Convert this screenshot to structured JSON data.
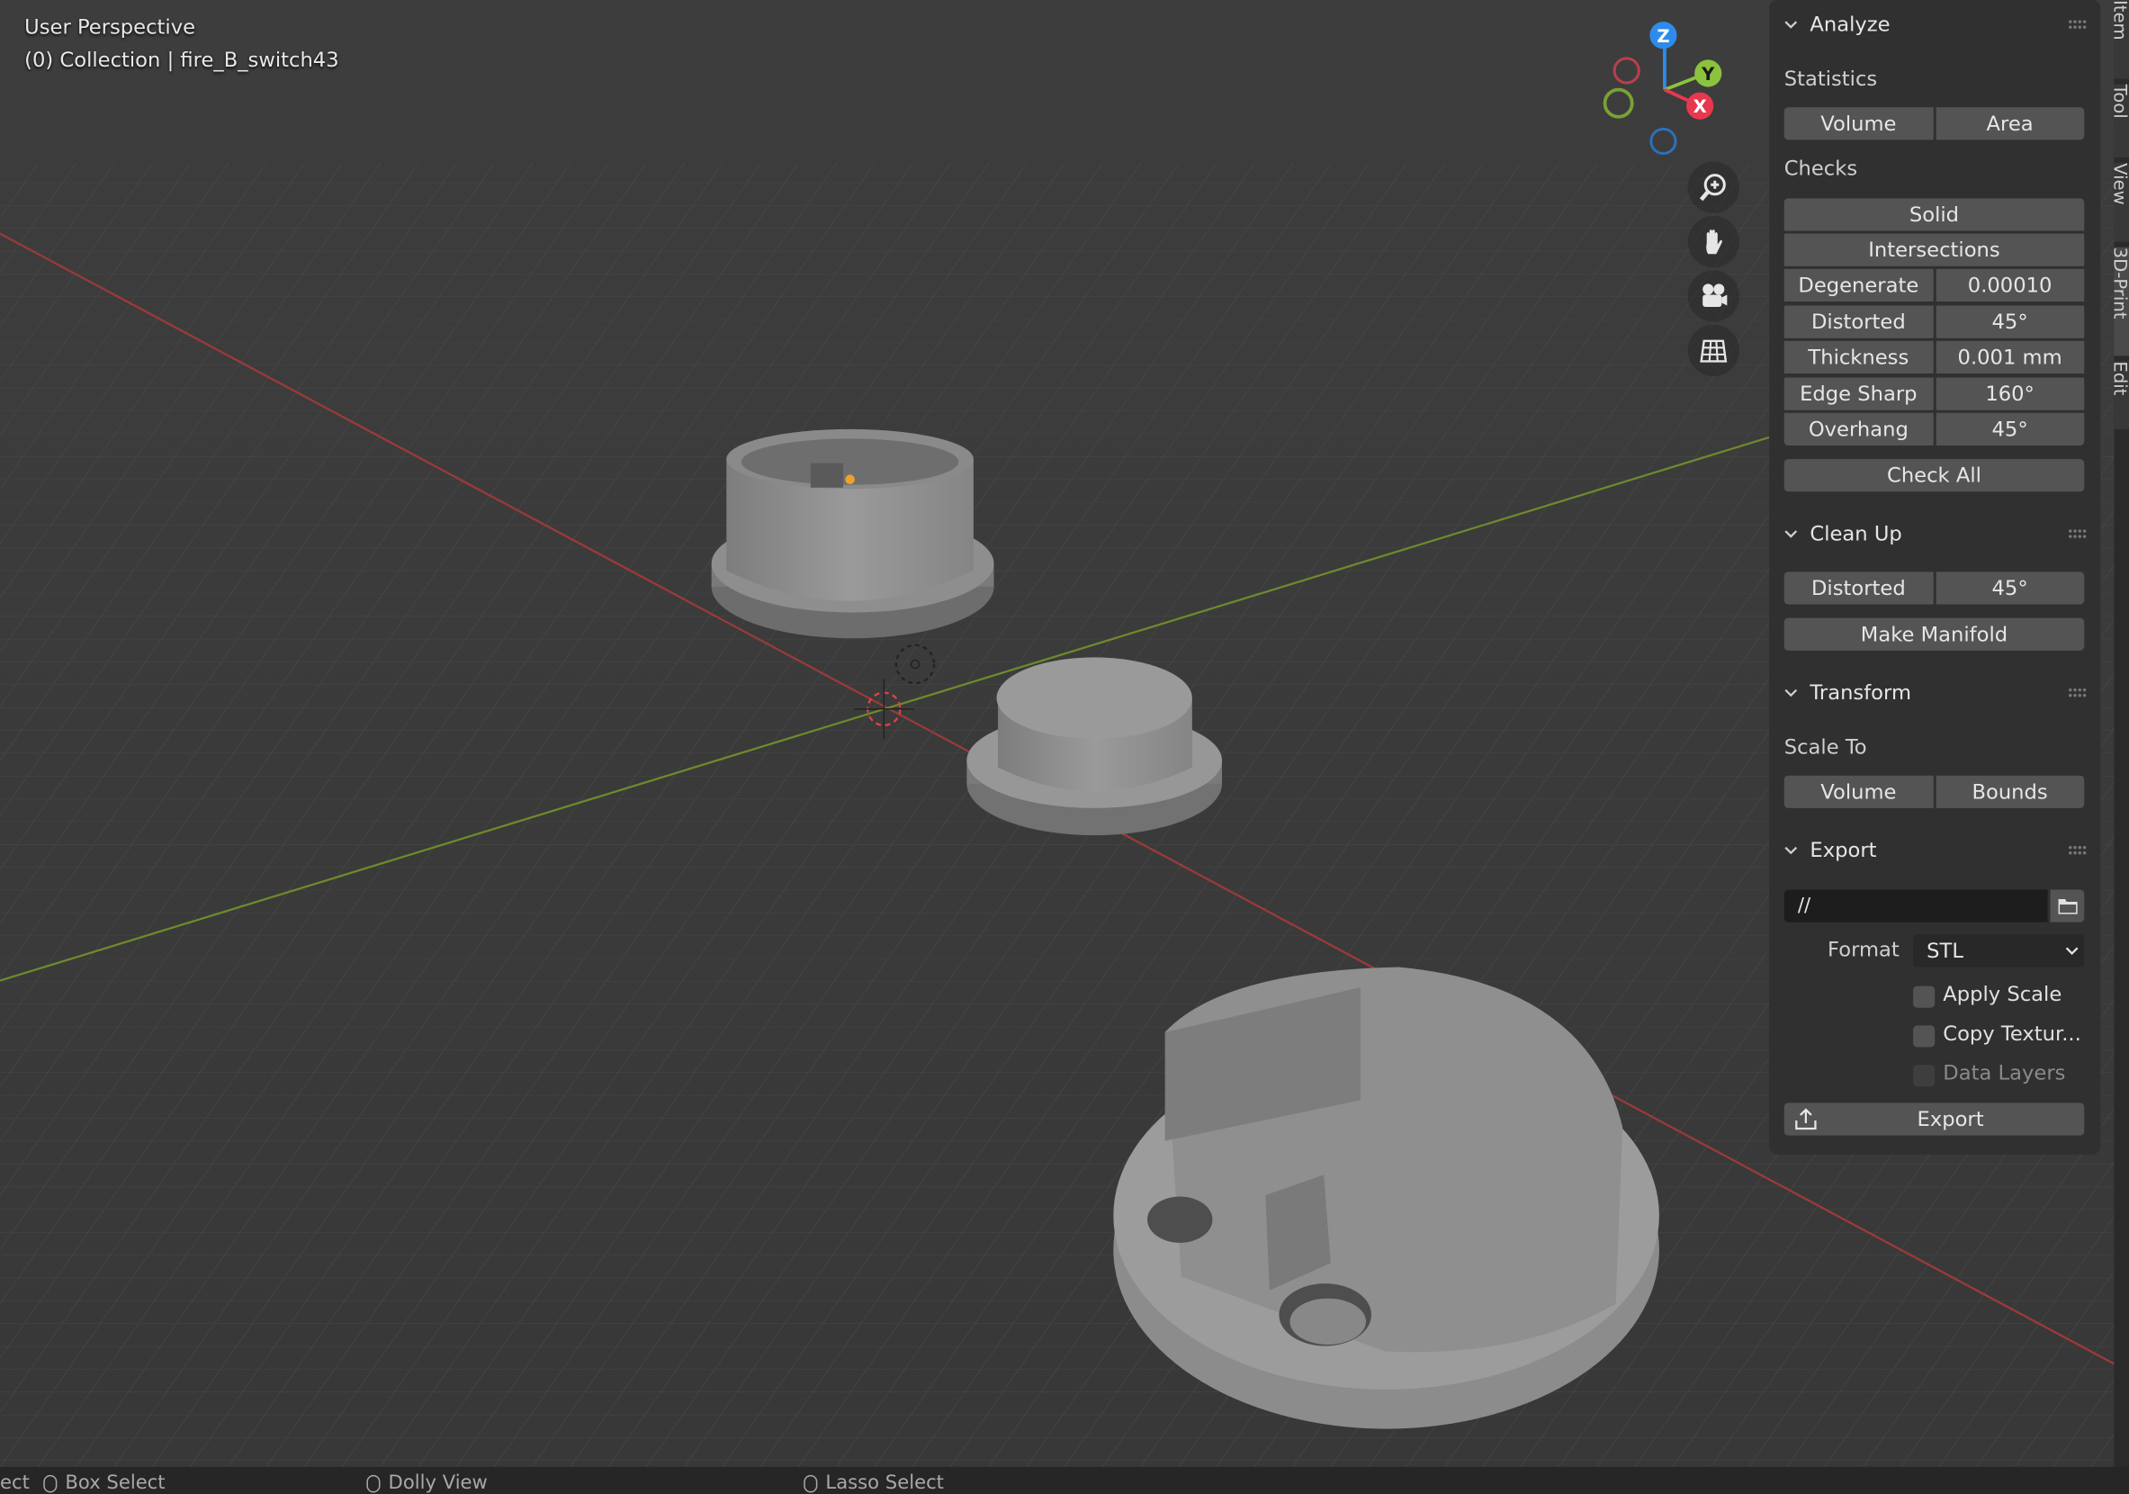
{
  "viewport": {
    "line1": "User Perspective",
    "line2": "(0) Collection | fire_B_switch43",
    "gizmo": {
      "z": "Z",
      "y": "Y",
      "x": "X",
      "colors": {
        "x": "#e8384f",
        "y": "#8bc33e",
        "z": "#2d8ceb"
      }
    },
    "nav_icons": [
      "zoom-icon",
      "hand-pan-icon",
      "camera-icon",
      "grid-ortho-icon"
    ]
  },
  "panel": {
    "analyze": {
      "title": "Analyze",
      "statistics_label": "Statistics",
      "volume": "Volume",
      "area": "Area",
      "checks_label": "Checks",
      "solid": "Solid",
      "intersections": "Intersections",
      "rows": [
        {
          "label": "Degenerate",
          "value": "0.00010"
        },
        {
          "label": "Distorted",
          "value": "45°"
        },
        {
          "label": "Thickness",
          "value": "0.001 mm"
        },
        {
          "label": "Edge Sharp",
          "value": "160°"
        },
        {
          "label": "Overhang",
          "value": "45°"
        }
      ],
      "check_all": "Check All"
    },
    "cleanup": {
      "title": "Clean Up",
      "distorted_label": "Distorted",
      "distorted_value": "45°",
      "make_manifold": "Make Manifold"
    },
    "transform": {
      "title": "Transform",
      "scale_to": "Scale To",
      "volume": "Volume",
      "bounds": "Bounds"
    },
    "export": {
      "title": "Export",
      "path": "//",
      "format_label": "Format",
      "format_value": "STL",
      "apply_scale": "Apply Scale",
      "copy_textures": "Copy Textur...",
      "data_layers": "Data Layers",
      "export_button": "Export"
    }
  },
  "tabs": [
    "Item",
    "Tool",
    "View",
    "3D-Print",
    "Edit"
  ],
  "statusbar": {
    "select": "ect",
    "box_select": "Box Select",
    "dolly_view": "Dolly View",
    "lasso_select": "Lasso Select"
  }
}
